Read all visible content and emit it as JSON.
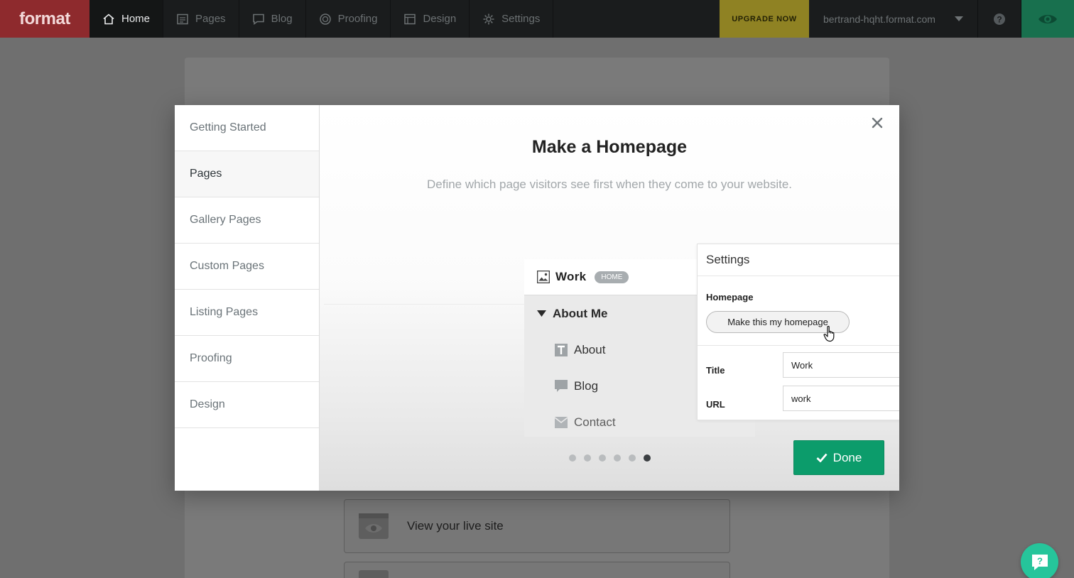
{
  "topnav": {
    "logo": "format",
    "items": [
      {
        "label": "Home",
        "icon": "home-icon"
      },
      {
        "label": "Pages",
        "icon": "pages-icon"
      },
      {
        "label": "Blog",
        "icon": "blog-icon"
      },
      {
        "label": "Proofing",
        "icon": "proofing-icon"
      },
      {
        "label": "Design",
        "icon": "design-icon"
      },
      {
        "label": "Settings",
        "icon": "gear-icon"
      }
    ],
    "upgrade": "UPGRADE NOW",
    "domain": "bertrand-hqht.format.com"
  },
  "background": {
    "rows": [
      {
        "label": "View your live site",
        "icon": "eye-icon"
      }
    ]
  },
  "modal": {
    "sidebar": [
      "Getting Started",
      "Pages",
      "Gallery Pages",
      "Custom Pages",
      "Listing Pages",
      "Proofing",
      "Design"
    ],
    "active_index": 1,
    "title": "Make a Homepage",
    "subtitle": "Define which page visitors see first when they come to your website.",
    "illustration": {
      "page_list": {
        "home_page": "Work",
        "home_badge": "HOME",
        "parent": "About Me",
        "children": [
          "About",
          "Blog",
          "Contact"
        ]
      },
      "settings": {
        "title": "Settings",
        "homepage_label": "Homepage",
        "homepage_button": "Make this my homepage",
        "title_label": "Title",
        "title_value": "Work",
        "url_label": "URL",
        "url_value": "work"
      }
    },
    "pagination": {
      "total": 6,
      "current": 6
    },
    "done": "Done"
  },
  "colors": {
    "logo_bg": "#8e2a2d",
    "upgrade_bg": "#8f8223",
    "preview_bg": "#18704e",
    "done_bg": "#0c9c6b",
    "chat_bg": "#26c59b"
  }
}
